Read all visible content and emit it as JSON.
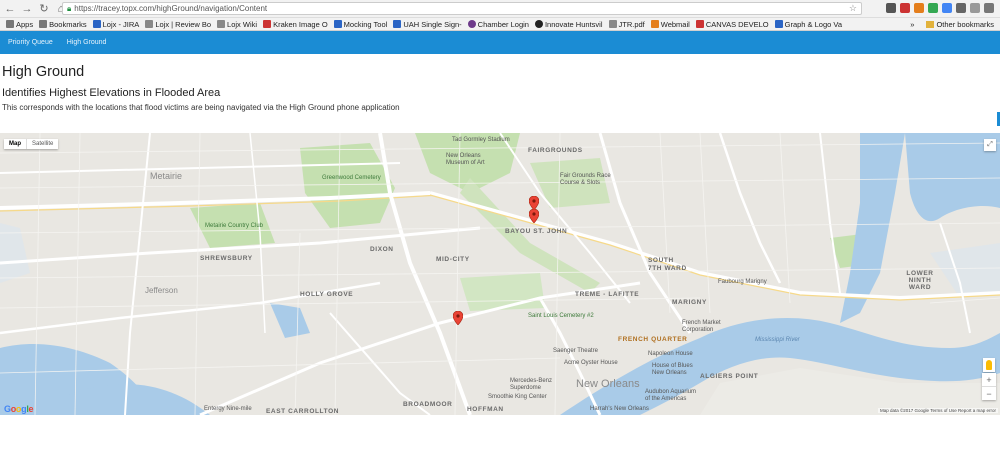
{
  "browser": {
    "url": "https://tracey.topx.com/highGround/navigation/Content",
    "bookmarks": [
      {
        "label": "Apps",
        "color": "#777"
      },
      {
        "label": "Bookmarks",
        "color": "#777"
      },
      {
        "label": "Lojx - JIRA",
        "color": "#2a64c5"
      },
      {
        "label": "Lojx | Review Bo",
        "color": "#888"
      },
      {
        "label": "Lojx Wiki",
        "color": "#888"
      },
      {
        "label": "Kraken Image O",
        "color": "#c33"
      },
      {
        "label": "Mocking Tool",
        "color": "#2a64c5"
      },
      {
        "label": "UAH Single Sign-",
        "color": "#2a64c5"
      },
      {
        "label": "Chamber Login",
        "color": "#6d3a8a"
      },
      {
        "label": "Innovate Huntsvil",
        "color": "#222"
      },
      {
        "label": "JTR.pdf",
        "color": "#888"
      },
      {
        "label": "Webmail",
        "color": "#e47e1c"
      },
      {
        "label": "CANVAS DEVELO",
        "color": "#c33"
      },
      {
        "label": "Graph & Logo Va",
        "color": "#2a64c5"
      }
    ],
    "more_bookmarks": "»",
    "other_bookmarks": "Other bookmarks"
  },
  "navbar": {
    "items": [
      "Priority Queue",
      "High Ground"
    ]
  },
  "page": {
    "title": "High Ground",
    "subtitle": "Identifies Highest Elevations in Flooded Area",
    "description": "This corresponds with the locations that flood victims are being navigated via the High Ground phone application"
  },
  "map": {
    "type_buttons": [
      "Map",
      "Satellite"
    ],
    "google_logo": "Google",
    "attribution": "Map data ©2017 Google   Terms of Use   Report a map error",
    "zoom_in": "+",
    "zoom_out": "−",
    "labels": {
      "tad_gormley": "Tad Gormley Stadium",
      "museum": "New Orleans Museum of Art",
      "fairgrounds": "FAIRGROUNDS",
      "fair_grounds_race": "Fair Grounds Race Course & Slots",
      "metairie": "Metairie",
      "greenwood": "Greenwood Cemetery",
      "metairie_country_club": "Metairie Country Club",
      "dixon": "DIXON",
      "bayou_st_john": "BAYOU ST. JOHN",
      "mid_city": "MID-CITY",
      "seventh_ward": "7TH WARD",
      "south_ward": "SOUTH",
      "lower_ninth": "LOWER NINTH WARD",
      "shrewsbury": "SHREWSBURY",
      "jefferson": "Jefferson",
      "holly_grove": "HOLLY GROVE",
      "treme": "TREME - LAFITTE",
      "marigny": "MARIGNY",
      "faubourg_marigny": "Faubourg Marigny",
      "saint_louis": "Saint Louis Cemetery #2",
      "french_quarter": "FRENCH QUARTER",
      "french_market": "French Market Corporation",
      "saenger": "Saenger Theatre",
      "acme": "Acme Oyster House",
      "napoleon": "Napoleon House",
      "house_blues": "House of Blues New Orleans",
      "new_orleans": "New Orleans",
      "algiers_point": "ALGIERS POINT",
      "mercedes": "Mercedes-Benz Superdome",
      "smoothie": "Smoothie King Center",
      "audubon": "Audubon Aquarium of the Americas",
      "broadmoor": "BROADMOOR",
      "hoffman": "HOFFMAN",
      "east_carrollton": "EAST CARROLLTON",
      "harrahs": "Harrah's New Orleans",
      "entergy": "Entergy Nine-mile",
      "mississippi": "Mississippi River"
    }
  },
  "colors": {
    "navbar": "#1b8cd4",
    "marker": "#ea4335",
    "water": "#a9cbe8",
    "park": "#c5e0b0",
    "land": "#e9e7e2",
    "road": "#ffffff"
  }
}
